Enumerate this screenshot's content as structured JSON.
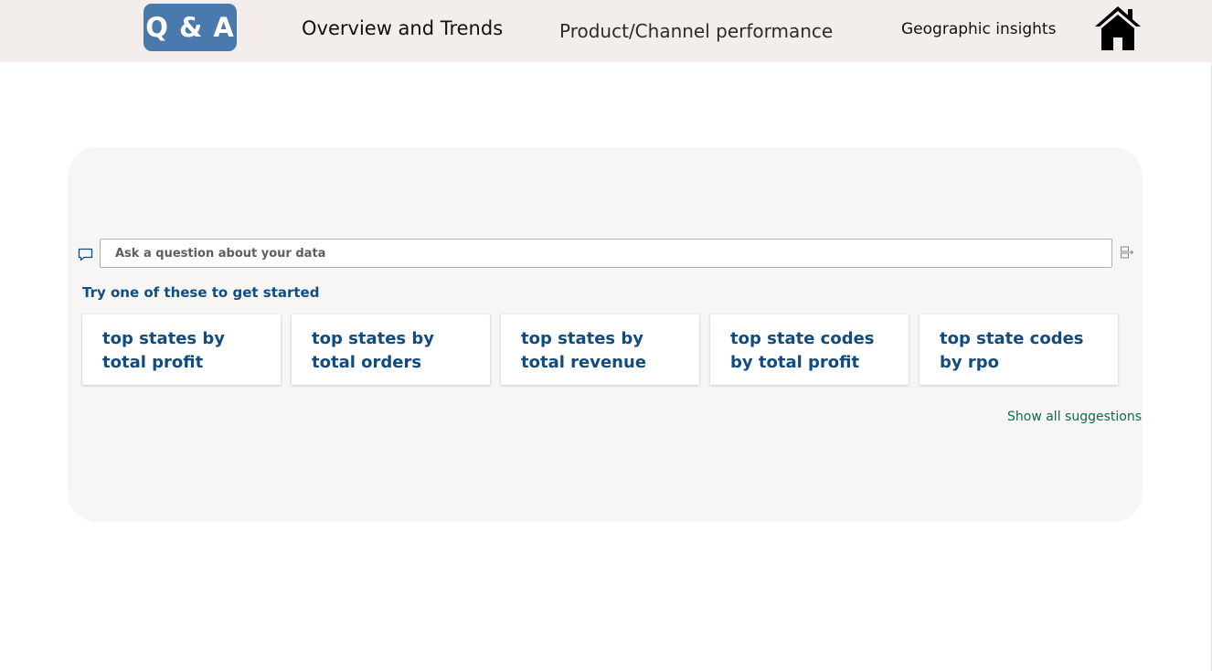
{
  "topbar": {
    "qa_button_label": "Q & A",
    "nav": {
      "overview": "Overview and Trends",
      "product": "Product/Channel performance",
      "geo": "Geographic insights"
    },
    "home_icon": "home-icon"
  },
  "qa": {
    "input_placeholder": "Ask a question about your data",
    "input_value": "",
    "try_label": "Try one of these to get started",
    "suggestions": [
      "top states by total profit",
      "top states by total orders",
      "top states by total revenue",
      "top state codes by total profit",
      "top state codes by rpo"
    ],
    "show_all": "Show all suggestions",
    "icons": {
      "chat": "chat-bubble-icon",
      "convert": "convert-to-visual-icon"
    }
  },
  "colors": {
    "topbar_bg": "#f3eeec",
    "qa_button": "#4a79ad",
    "suggestion_text": "#114b7f",
    "link": "#0d6a50",
    "panel_bg": "#f7f6f5"
  }
}
